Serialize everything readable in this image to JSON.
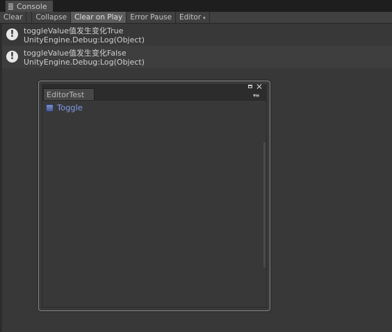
{
  "console_tab": {
    "label": "Console",
    "icon": "console-list-icon"
  },
  "toolbar": {
    "buttons": [
      {
        "label": "Clear",
        "active": false
      },
      {
        "label": "Collapse",
        "active": false
      },
      {
        "label": "Clear on Play",
        "active": true
      },
      {
        "label": "Error Pause",
        "active": false
      },
      {
        "label": "Editor",
        "active": false,
        "dropdown": true
      }
    ],
    "dropdown_caret": "▾"
  },
  "logs": [
    {
      "line1": "toggleValue值发生变化True",
      "line2": "UnityEngine.Debug:Log(Object)",
      "icon": "info-icon",
      "icon_glyph": "!"
    },
    {
      "line1": "toggleValue值发生变化False",
      "line2": "UnityEngine.Debug:Log(Object)",
      "icon": "info-icon",
      "icon_glyph": "!"
    }
  ],
  "editor_window": {
    "tab_label": "EditorTest",
    "close_glyph": "✕",
    "menu_glyph": "▾≡",
    "toggle": {
      "label": "Toggle",
      "checked": false
    }
  }
}
